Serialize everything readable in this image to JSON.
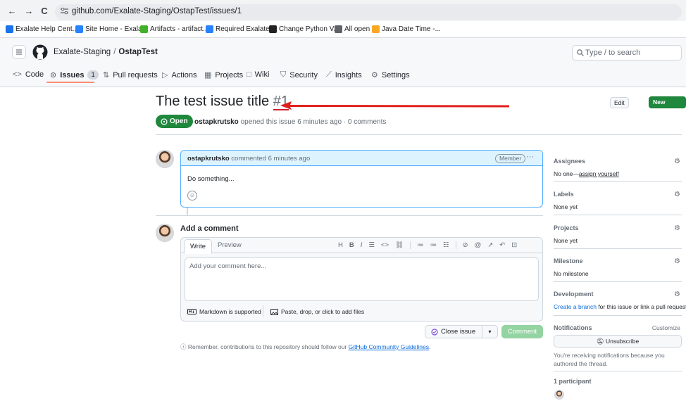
{
  "browser": {
    "back": "←",
    "forward": "→",
    "reload": "C",
    "url": "github.com/Exalate-Staging/OstapTest/issues/1"
  },
  "bookmarks": [
    {
      "label": "Exalate Help Cent...",
      "color": "#1a73e8"
    },
    {
      "label": "Site Home - Exala...",
      "color": "#2684ff"
    },
    {
      "label": "Artifacts - artifact...",
      "color": "#43b02a"
    },
    {
      "label": "Required Exalate...",
      "color": "#2684ff"
    },
    {
      "label": "Change Python V...",
      "color": "#222222"
    },
    {
      "label": "All open",
      "color": "#5f6368"
    },
    {
      "label": "Java Date Time -...",
      "color": "#f9a825"
    }
  ],
  "header": {
    "owner": "Exalate-Staging",
    "separator": "/",
    "repo": "OstapTest",
    "search_placeholder": "Type / to search"
  },
  "tabs": [
    {
      "label": "Code",
      "icon": "<>"
    },
    {
      "label": "Issues",
      "icon": "⊙",
      "count": "1"
    },
    {
      "label": "Pull requests",
      "icon": "⇅"
    },
    {
      "label": "Actions",
      "icon": "▷"
    },
    {
      "label": "Projects",
      "icon": "▦"
    },
    {
      "label": "Wiki",
      "icon": "□"
    },
    {
      "label": "Security",
      "icon": "⛉"
    },
    {
      "label": "Insights",
      "icon": "⟋"
    },
    {
      "label": "Settings",
      "icon": "⚙"
    }
  ],
  "issue": {
    "title": "The test issue title",
    "number": "#1",
    "state": "Open",
    "author": "ostapkrutsko",
    "meta": "opened this issue 6 minutes ago · 0 comments",
    "edit_label": "Edit",
    "new_issue_label": "New issue"
  },
  "comment": {
    "author": "ostapkrutsko",
    "action": "commented 6 minutes ago",
    "badge": "Member",
    "kebab": "···",
    "body": "Do something..."
  },
  "editor": {
    "heading": "Add a comment",
    "tab_write": "Write",
    "tab_preview": "Preview",
    "toolbar": [
      "H",
      "B",
      "I",
      "☰",
      "<>",
      "⛓",
      "|",
      "≔",
      "≔",
      "☷",
      "|",
      "⊘",
      "@",
      "↗",
      "↶",
      "⊡"
    ],
    "placeholder": "Add your comment here...",
    "markdown_note": "Markdown is supported",
    "attach_note": "Paste, drop, or click to add files",
    "close_issue": "Close issue",
    "dropdown": "▾",
    "comment_button": "Comment",
    "guidelines_prefix": "Remember, contributions to this repository should follow our",
    "guidelines_link": "GitHub Community Guidelines",
    "guidelines_suffix": "."
  },
  "sidebar": {
    "assignees": {
      "title": "Assignees",
      "value_prefix": "No one—",
      "value_link": "assign yourself"
    },
    "labels": {
      "title": "Labels",
      "value": "None yet"
    },
    "projects": {
      "title": "Projects",
      "value": "None yet"
    },
    "milestone": {
      "title": "Milestone",
      "value": "No milestone"
    },
    "development": {
      "title": "Development",
      "value_link": "Create a branch",
      "value_suffix": " for this issue or link a pull request."
    },
    "notifications": {
      "title": "Notifications",
      "customize": "Customize",
      "button": "Unsubscribe",
      "note": "You're receiving notifications because you authored the thread."
    },
    "participants": {
      "title": "1 participant"
    }
  },
  "colors": {
    "accent_green": "#1f883d",
    "link_blue": "#0969da",
    "annotation_red": "#cf222e"
  }
}
